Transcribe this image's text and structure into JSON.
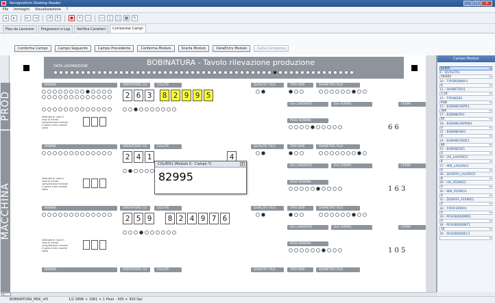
{
  "window": {
    "title": "Recognoform Desktop Reader",
    "minimize": "_",
    "maximize": "□",
    "close": "✕"
  },
  "menu": [
    "File",
    "Immagini",
    "Visualizzazione",
    "?"
  ],
  "tabs": [
    "Flex da Lavorare",
    "Progressivi e Log",
    "Verifica Caratteri",
    "Correzione Campi"
  ],
  "active_tab_index": 3,
  "actions": [
    "Conferma Campo",
    "Campo Seguente",
    "Campo Precedente",
    "Conferma Modulo",
    "Scarta Modulo",
    "DataEntry Modulo",
    "Salta Correzione"
  ],
  "form": {
    "title": "BOBINATURA - Tavolo rilevazione produzione",
    "data_label": "DATA LAVORAZIONE",
    "side_prod": "PROD",
    "side_macchina": "MACCHINA",
    "rows": [
      {
        "operatore": [
          "2",
          "6",
          "3"
        ],
        "colata": [
          "8",
          "2",
          "9",
          "9",
          "5"
        ],
        "extra": "6 6"
      },
      {
        "operatore": [
          "2",
          "4",
          "1"
        ],
        "colata": [
          "",
          "",
          "",
          "",
          "",
          "4"
        ],
        "extra": "1 6 3"
      },
      {
        "operatore": [
          "2",
          "5",
          "9"
        ],
        "colata": [
          "8",
          "2",
          "4",
          "9",
          "7",
          "6"
        ],
        "extra": "1 0 5"
      }
    ],
    "section_labels": {
      "bobine": "BOBINE",
      "plw": "PLW",
      "rw_rpt": "RW RPT",
      "operatore": "OPERATORE CQ",
      "colata": "COLATE",
      "qualita": "QUALITA' FILO",
      "tipo": "TIPO BOB",
      "diametro": "DIAMETRO FILO",
      "ore": "Ore LAVORATE",
      "fermo": "Ore FERMO",
      "fermi": "FERMI",
      "peso": "PESO BOBINA"
    },
    "note": "Attenzione: solo in caso di errata compilazione indicare il valore nelle caselle sotto"
  },
  "popup": {
    "title": "COLATA1 (Modulo 0 - Campo 7)",
    "value": "82995",
    "close": "x"
  },
  "fields_panel": {
    "title": "Campo Modulo",
    "fields": [
      {
        "label": "",
        "value": "82995",
        "selected": true
      },
      {
        "label": "8 - QUALITA1",
        "value": "56/S02"
      },
      {
        "label": "10 - TIPOBOBINA1",
        "value": "6"
      },
      {
        "label": "11 - DIAMETRO1",
        "value": "1.20"
      },
      {
        "label": "12 - TIPOBOB1",
        "value": "PLW"
      },
      {
        "label": "15 - BOBINEORPR1",
        "value": "300"
      },
      {
        "label": "17 - BOBINEPR1",
        "value": "65"
      },
      {
        "label": "18 - BOBINEORPRW1",
        "value": "0"
      },
      {
        "label": "21 - BOBINERW1",
        "value": "0"
      },
      {
        "label": "24 - BOBINEORDE1",
        "value": "80"
      },
      {
        "label": "25 - BOBINEDE1",
        "value": "0"
      },
      {
        "label": "26 - HH_LAVORO1",
        "value": "8"
      },
      {
        "label": "27 - MM_LAVORO1",
        "value": "0"
      },
      {
        "label": "28 - DURATA_LAVORO1",
        "value": "8"
      },
      {
        "label": "29 - HH_FERMO1",
        "value": "0"
      },
      {
        "label": "30 - MM_FERMO1",
        "value": "0"
      },
      {
        "label": "31 - DURATA_FERMO1",
        "value": "0"
      },
      {
        "label": "32 - TIPOFERMO1",
        "value": "0"
      },
      {
        "label": "33 - PESOBOBDMR1",
        "value": "0"
      },
      {
        "label": "34 - PESOBOBDNT1",
        "value": "16"
      },
      {
        "label": "35 - PESOBOBDEC1",
        "value": ""
      }
    ]
  },
  "page_indicator": "1",
  "status": [
    "BOBINATURA_MSK_vf0",
    "1/2 2896 × 1961 × 1 Pixel - 300 × 300 Dpi"
  ]
}
